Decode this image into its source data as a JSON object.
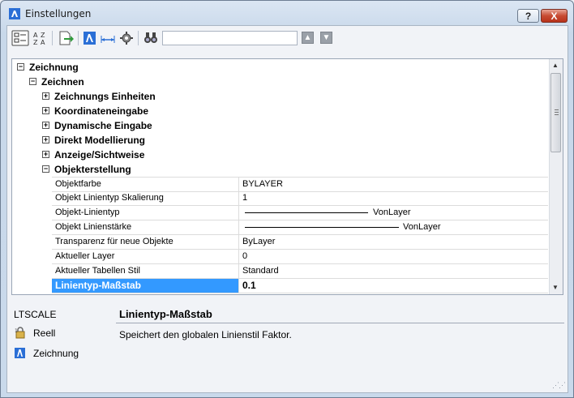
{
  "window": {
    "title": "Einstellungen",
    "help_label": "?",
    "close_label": "X"
  },
  "toolbar": {
    "search_value": "",
    "icons": [
      "categorized-view-icon",
      "alphabetical-sort-icon",
      "export-icon",
      "drawing-settings-icon",
      "dimension-icon",
      "system-settings-icon",
      "find-icon"
    ],
    "nav_up_label": "▲",
    "nav_down_label": "▼"
  },
  "tree": {
    "root": "Zeichnung",
    "group": "Zeichnen",
    "nodes": [
      {
        "label": "Zeichnungs Einheiten",
        "expanded": false
      },
      {
        "label": "Koordinateneingabe",
        "expanded": false
      },
      {
        "label": "Dynamische Eingabe",
        "expanded": false
      },
      {
        "label": "Direkt Modellierung",
        "expanded": false
      },
      {
        "label": "Anzeige/Sichtweise",
        "expanded": false
      },
      {
        "label": "Objekterstellung",
        "expanded": true
      }
    ],
    "properties": [
      {
        "name": "Objektfarbe",
        "value": "BYLAYER"
      },
      {
        "name": "Objekt Linientyp Skalierung",
        "value": "1"
      },
      {
        "name": "Objekt-Linientyp",
        "value": "VonLayer"
      },
      {
        "name": "Objekt Linienstärke",
        "value": "VonLayer"
      },
      {
        "name": "Transparenz für neue Objekte",
        "value": "ByLayer"
      },
      {
        "name": "Aktueller Layer",
        "value": "0"
      },
      {
        "name": "Aktueller Tabellen Stil",
        "value": "Standard"
      },
      {
        "name": "Linientyp-Maßstab",
        "value": "0.1",
        "selected": true
      }
    ]
  },
  "description": {
    "command": "LTSCALE",
    "title": "Linientyp-Maßstab",
    "text": "Speichert den globalen Linienstil Faktor.",
    "scopes": [
      {
        "icon": "real-type-icon",
        "label": "Reell"
      },
      {
        "icon": "drawing-scope-icon",
        "label": "Zeichnung"
      }
    ]
  },
  "colors": {
    "selection": "#3399ff",
    "app_icon": "#2b6fd6"
  }
}
